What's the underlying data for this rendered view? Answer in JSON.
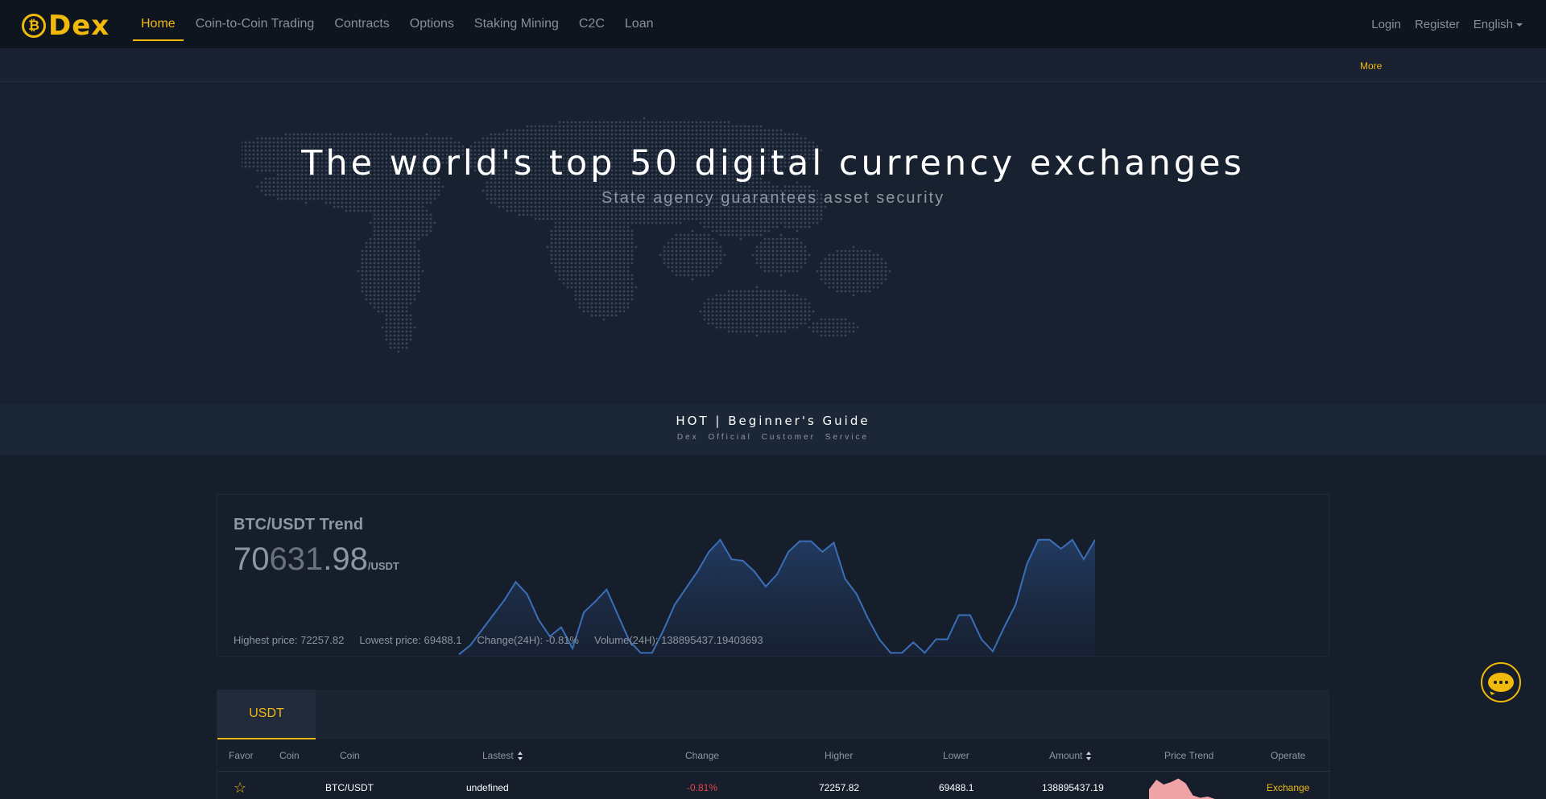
{
  "brand": {
    "name": "Dex",
    "coin_glyph": "₿",
    "accent": "#f0b90b"
  },
  "nav": {
    "items": [
      {
        "label": "Home",
        "active": true
      },
      {
        "label": "Coin-to-Coin Trading"
      },
      {
        "label": "Contracts"
      },
      {
        "label": "Options"
      },
      {
        "label": "Staking Mining"
      },
      {
        "label": "C2C"
      },
      {
        "label": "Loan"
      }
    ],
    "login": "Login",
    "register": "Register",
    "language": "English"
  },
  "notice": {
    "more": "More"
  },
  "hero": {
    "title": "The world's top 50 digital currency exchanges",
    "subtitle": "State agency guarantees asset security"
  },
  "guide": {
    "title": "HOT | Beginner's Guide",
    "subtitle": "Dex Official Customer Service"
  },
  "trend": {
    "title": "BTC/USDT Trend",
    "price_part1": "70",
    "price_part2": "631",
    "price_part3": ".98",
    "unit": "/USDT",
    "highest": "Highest price: 72257.82",
    "lowest": "Lowest price: 69488.1",
    "change": "Change(24H): -0.81%",
    "volume": "Volume(24H): 138895437.19403693"
  },
  "chart_data": {
    "type": "area",
    "title": "",
    "series": [
      {
        "values": [
          2,
          8,
          18,
          28,
          38,
          50,
          42,
          25,
          14,
          20,
          6,
          30,
          37,
          45,
          28,
          11,
          3,
          3,
          18,
          35,
          46,
          57,
          70,
          78,
          65,
          64,
          57,
          47,
          55,
          70,
          77,
          77,
          70,
          76,
          52,
          42,
          26,
          12,
          3,
          3,
          10,
          3,
          12,
          12,
          28,
          28,
          12,
          4,
          20,
          35,
          62,
          78,
          78,
          72,
          78,
          65,
          78
        ]
      }
    ],
    "color": "#3a6fb8",
    "grid": false,
    "legend": "none"
  },
  "market": {
    "tab": "USDT",
    "columns": {
      "favor": "Favor",
      "coin": "Coin",
      "coin2": "Coin",
      "latest": "Lastest",
      "change": "Change",
      "higher": "Higher",
      "lower": "Lower",
      "amount": "Amount",
      "trend": "Price Trend",
      "operate": "Operate"
    },
    "rows": [
      {
        "star": "☆",
        "pair": "BTC/USDT",
        "latest": "undefined",
        "change": "-0.81%",
        "higher": "72257.82",
        "lower": "69488.1",
        "amount": "138895437.19",
        "operate": "Exchange",
        "spark": [
          10,
          18,
          14,
          16,
          19,
          15,
          5,
          3,
          4,
          2,
          2,
          1
        ]
      }
    ]
  },
  "chat": {
    "icon": "chat-icon"
  }
}
